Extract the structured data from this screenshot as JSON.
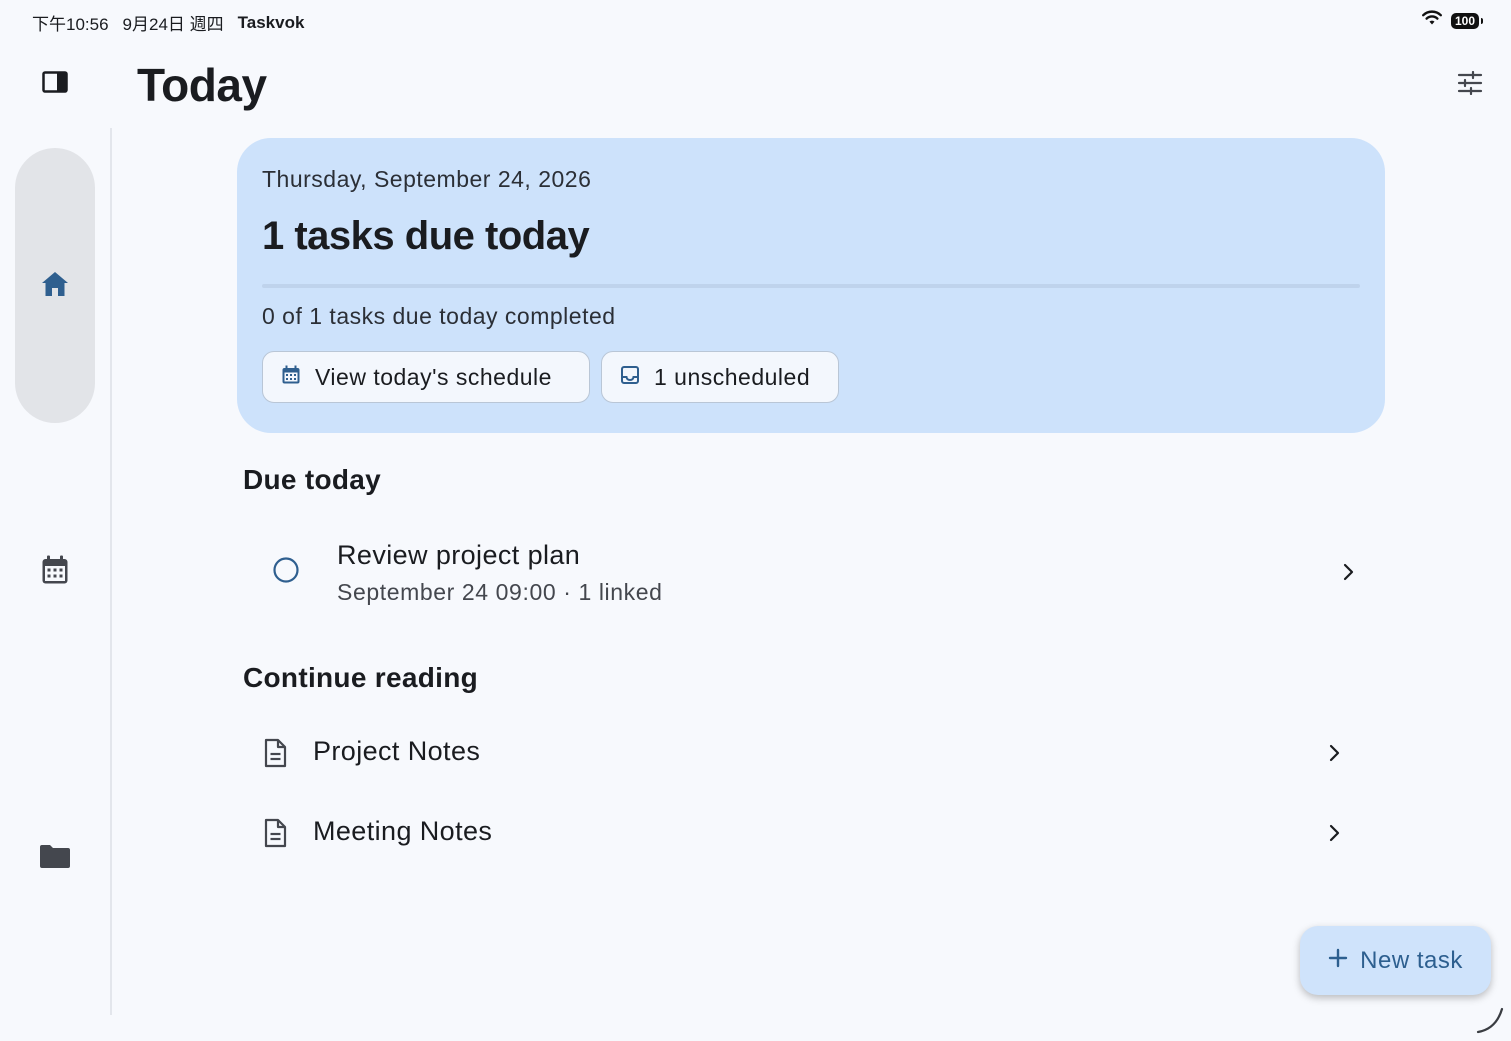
{
  "status_bar": {
    "time": "下午10:56",
    "date": "9月24日 週四",
    "app_name": "Taskvok",
    "battery": "100"
  },
  "header": {
    "title": "Today"
  },
  "hero": {
    "date": "Thursday, September 24, 2026",
    "headline": "1 tasks due today",
    "progress_fraction": 0,
    "progress_text": "0 of 1 tasks due today completed",
    "schedule_button": "View today's schedule",
    "unscheduled_button": "1 unscheduled"
  },
  "due_today": {
    "title": "Due today",
    "tasks": [
      {
        "title": "Review project plan",
        "meta": "September 24 09:00 · 1 linked"
      }
    ]
  },
  "continue_reading": {
    "title": "Continue reading",
    "items": [
      {
        "title": "Project Notes"
      },
      {
        "title": "Meeting Notes"
      }
    ]
  },
  "fab": {
    "label": "New task"
  },
  "colors": {
    "background": "#f7f9fd",
    "hero_background": "#cde2fb",
    "accent": "#3c6793",
    "rail_pill": "#e2e4e8"
  },
  "icons": {
    "sidebar_toggle": "sidebar-toggle-icon",
    "filter": "tune-icon",
    "nav": [
      "home-icon",
      "calendar-icon",
      "folder-icon"
    ],
    "schedule": "calendar-icon",
    "unscheduled": "inbox-icon",
    "task": "circle-checkbox-icon",
    "document": "document-icon",
    "chevron": "chevron-right-icon",
    "fab": "plus-icon"
  }
}
